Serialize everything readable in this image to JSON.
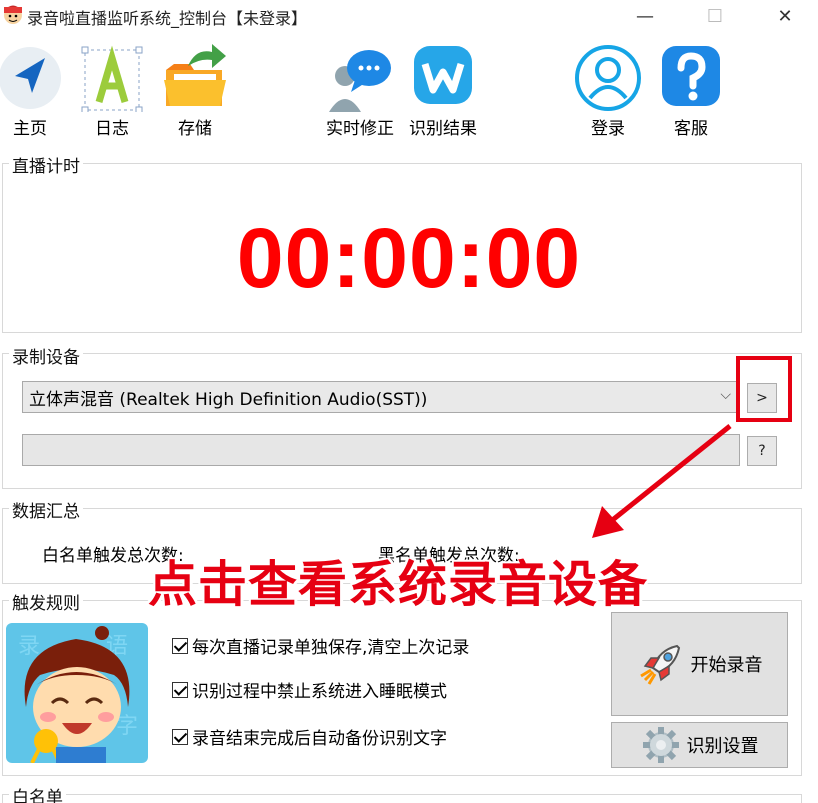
{
  "window": {
    "title": "录音啦直播监听系统_控制台【未登录】",
    "min_glyph": "—",
    "max_glyph": "☐",
    "close_glyph": "✕"
  },
  "toolbar": {
    "home": "主页",
    "log": "日志",
    "storage": "存储",
    "realtime_fix": "实时修正",
    "results": "识别结果",
    "login": "登录",
    "support": "客服"
  },
  "timer_group": {
    "title": "直播计时",
    "time": "00:00:00"
  },
  "device_group": {
    "title": "录制设备",
    "selected_device": "立体声混音 (Realtek High Definition Audio(SST))",
    "chevron": "⌵",
    "more_button": ">",
    "help_button": "?",
    "progress": 0
  },
  "stats_group": {
    "title": "数据汇总",
    "whitelist_label": "白名单触发总次数:",
    "other_label": "黑名单触发总次数:"
  },
  "annotation": {
    "text": "点击查看系统录音设备"
  },
  "rules_group": {
    "title": "触发规则",
    "options": [
      "每次直播记录单独保存,清空上次记录",
      "识别过程中禁止系统进入睡眠模式",
      "录音结束完成后自动备份识别文字"
    ],
    "start_button": "开始录音",
    "settings_button": "识别设置"
  },
  "whitelist_group": {
    "title": "白名单"
  },
  "colors": {
    "timer": "#ff0000",
    "annotation": "#e60012",
    "accent_blue": "#1e88e5"
  }
}
